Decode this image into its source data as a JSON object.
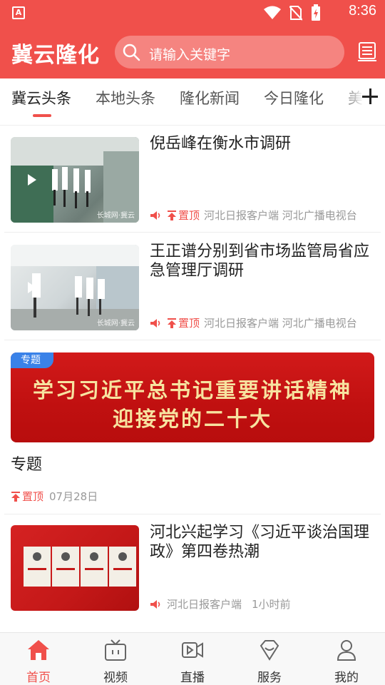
{
  "status_bar": {
    "time": "8:36",
    "app_badge": "A"
  },
  "header": {
    "logo": "冀云隆化",
    "search_placeholder": "请输入关键字",
    "accent": "#f0504b"
  },
  "tabs": [
    {
      "label": "冀云头条",
      "active": true
    },
    {
      "label": "本地头条"
    },
    {
      "label": "隆化新闻"
    },
    {
      "label": "今日隆化"
    },
    {
      "label": "美"
    }
  ],
  "feed": [
    {
      "title": "倪岳峰在衡水市调研",
      "top_label": "置顶",
      "source": "河北日报客户端 河北广播电视台",
      "has_video": true
    },
    {
      "title": "王正谱分别到省市场监管局省应急管理厅调研",
      "top_label": "置顶",
      "source": "河北日报客户端 河北广播电视台",
      "has_video": true
    },
    {
      "title": "河北兴起学习《习近平谈治国理政》第四卷热潮",
      "source": "河北日报客户端",
      "time": "1小时前"
    }
  ],
  "topic": {
    "badge": "专题",
    "banner_line1": "学习习近平总书记重要讲话精神",
    "banner_line2": "迎接党的二十大",
    "title": "专题",
    "top_label": "置顶",
    "date": "07月28日"
  },
  "bottom_nav": [
    {
      "label": "首页",
      "icon": "home-icon",
      "active": true
    },
    {
      "label": "视频",
      "icon": "tv-icon"
    },
    {
      "label": "直播",
      "icon": "live-camera-icon"
    },
    {
      "label": "服务",
      "icon": "service-diamond-icon"
    },
    {
      "label": "我的",
      "icon": "profile-icon"
    }
  ]
}
